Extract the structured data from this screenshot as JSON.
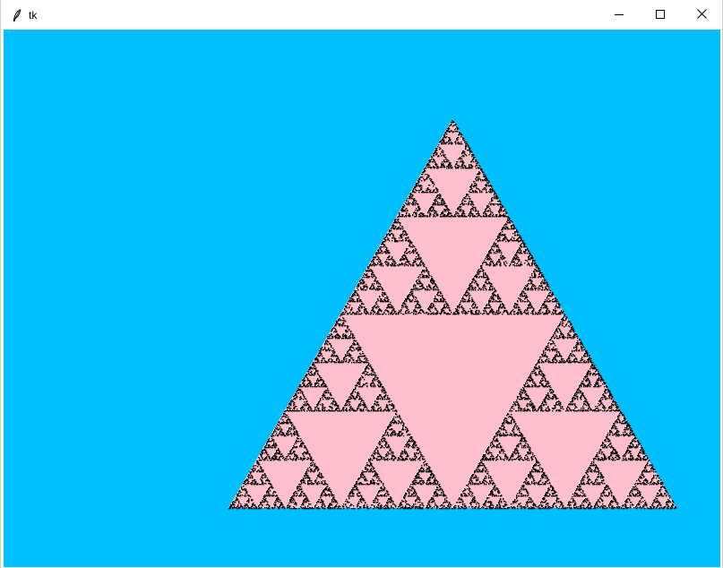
{
  "window": {
    "title": "tk",
    "app_icon": "feather-icon",
    "controls": {
      "minimize_icon": "minimize-icon",
      "maximize_icon": "maximize-icon",
      "close_icon": "close-icon"
    }
  },
  "canvas": {
    "background_color": "#00BFFF",
    "fractal_fill_color": "#FFC0CB",
    "fractal_dot_color": "#000000"
  }
}
